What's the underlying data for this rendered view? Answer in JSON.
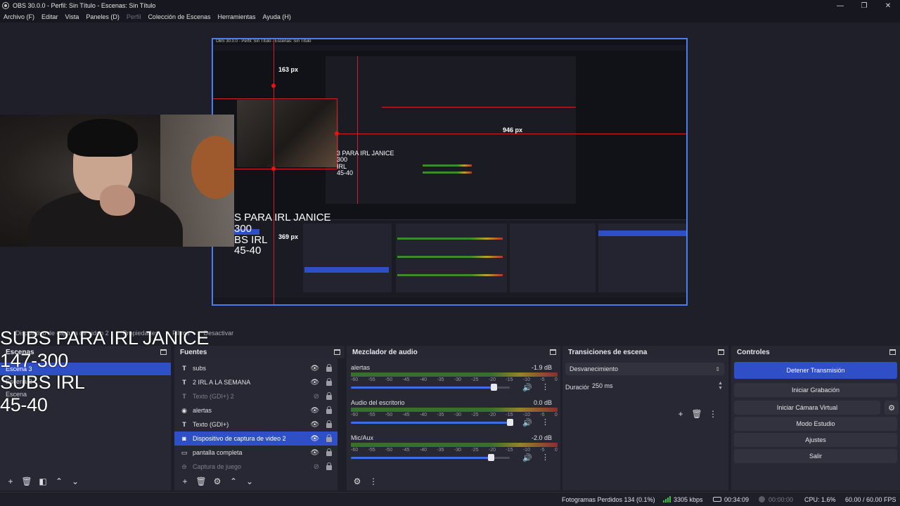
{
  "window": {
    "title": "OBS 30.0.0 - Perfil: Sin Título - Escenas: Sin Título",
    "controls": {
      "minimize": "—",
      "maximize": "❐",
      "close": "✕"
    }
  },
  "menu": {
    "items": [
      "Archivo (F)",
      "Editar",
      "Vista",
      "Paneles (D)",
      "Perfil",
      "Colección de Escenas",
      "Herramientas",
      "Ayuda (H)"
    ],
    "disabled": [
      "Perfil"
    ]
  },
  "preview": {
    "measure_top": "163 px",
    "measure_right": "946 px",
    "measure_left": "369 px",
    "nested_overlay": [
      "S PARA IRL JANICE",
      "300",
      "BS IRL",
      "45-40"
    ],
    "nested_overlay_small": [
      "3 PARA IRL JANICE",
      "300",
      "IRL",
      "45-40"
    ]
  },
  "overlay_text": [
    "SUBS PARA IRL JANICE",
    "147-300",
    "SUBS IRL",
    "45-40"
  ],
  "source_toolbar": {
    "items": [
      "Dispositivo de captura de video 2",
      "Propiedades",
      "Filtros",
      "Desactivar"
    ]
  },
  "docks": {
    "scenes": {
      "title": "Escenas",
      "items": [
        "Escena 3",
        "Escena 2",
        "Escena"
      ],
      "active_index": 0
    },
    "sources": {
      "title": "Fuentes",
      "items": [
        {
          "label": "subs",
          "icon": "text-icon",
          "visible": true
        },
        {
          "label": "2 IRL A LA SEMANA",
          "icon": "text-icon",
          "visible": true
        },
        {
          "label": "Texto (GDI+) 2",
          "icon": "text-icon",
          "visible": false
        },
        {
          "label": "alertas",
          "icon": "browser-icon",
          "visible": true
        },
        {
          "label": "Texto (GDI+)",
          "icon": "text-icon",
          "visible": true
        },
        {
          "label": "Dispositivo de captura de video 2",
          "icon": "camera-icon",
          "visible": true,
          "selected": true
        },
        {
          "label": "pantalla completa",
          "icon": "monitor-icon",
          "visible": true
        },
        {
          "label": "Captura de juego",
          "icon": "gamepad-icon",
          "visible": false
        }
      ]
    },
    "mixer": {
      "title": "Mezclador de audio",
      "scale": [
        "-60",
        "-55",
        "-50",
        "-45",
        "-40",
        "-35",
        "-30",
        "-25",
        "-20",
        "-15",
        "-10",
        "-5",
        "0"
      ],
      "channels": [
        {
          "name": "alertas",
          "db": "-1.9 dB",
          "volume": 0.9
        },
        {
          "name": "Audio del escritorio",
          "db": "0.0 dB",
          "volume": 1.0
        },
        {
          "name": "Mic/Aux",
          "db": "-2.0 dB",
          "volume": 0.88
        }
      ]
    },
    "transitions": {
      "title": "Transiciones de escena",
      "selected": "Desvanecimiento",
      "duration_label": "Duración",
      "duration_value": "250 ms"
    },
    "controls": {
      "title": "Controles",
      "buttons": [
        "Detener Transmisión",
        "Iniciar Grabación",
        "Iniciar Cámara Virtual",
        "Modo Estudio",
        "Ajustes",
        "Salir"
      ]
    }
  },
  "status": {
    "dropped_frames": "Fotogramas Perdidos 134 (0.1%)",
    "bitrate": "3305 kbps",
    "stream_time": "00:34:09",
    "rec_time": "00:00:00",
    "cpu": "CPU: 1.6%",
    "fps": "60.00 / 60.00 FPS"
  },
  "colors": {
    "accent": "#2f4fc7",
    "background": "#1e1f29",
    "panel": "#272833",
    "guide": "#d01f2a",
    "bounding": "#4a7eed"
  }
}
